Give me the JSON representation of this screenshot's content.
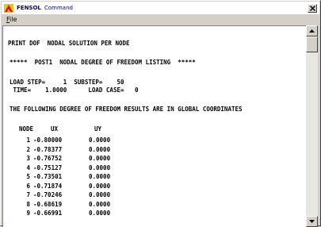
{
  "window": {
    "app_name": "FENSOL",
    "title": "Command",
    "close_icon": "close-x"
  },
  "menu": {
    "file_hotkey": "F",
    "file_rest": "ile"
  },
  "output": {
    "header_line": "PRINT DOF  NODAL SOLUTION PER NODE",
    "listing_title": "*****  POST1  NODAL DEGREE OF FREEDOM LISTING  *****",
    "load_step_line": "LOAD STEP=     1  SUBSTEP=    50",
    "time_line": " TIME=    1.0000      LOAD CASE=   0",
    "results_line": "THE FOLLOWING DEGREE OF FREEDOM RESULTS ARE IN GLOBAL COORDINATES",
    "columns": {
      "node": "NODE",
      "ux": "UX",
      "uy": "UY"
    },
    "rows": [
      {
        "node": "1",
        "ux": "-0.80000",
        "uy": "0.0000"
      },
      {
        "node": "2",
        "ux": "-0.78377",
        "uy": "0.0000"
      },
      {
        "node": "3",
        "ux": "-0.76752",
        "uy": "0.0000"
      },
      {
        "node": "4",
        "ux": "-0.75127",
        "uy": "0.0000"
      },
      {
        "node": "5",
        "ux": "-0.73501",
        "uy": "0.0000"
      },
      {
        "node": "6",
        "ux": "-0.71874",
        "uy": "0.0000"
      },
      {
        "node": "7",
        "ux": "-0.70246",
        "uy": "0.0000"
      },
      {
        "node": "8",
        "ux": "-0.68619",
        "uy": "0.0000"
      },
      {
        "node": "9",
        "ux": "-0.66991",
        "uy": "0.0000"
      }
    ]
  },
  "scrollbar": {
    "up_icon": "arrow-up",
    "down_icon": "arrow-down"
  }
}
